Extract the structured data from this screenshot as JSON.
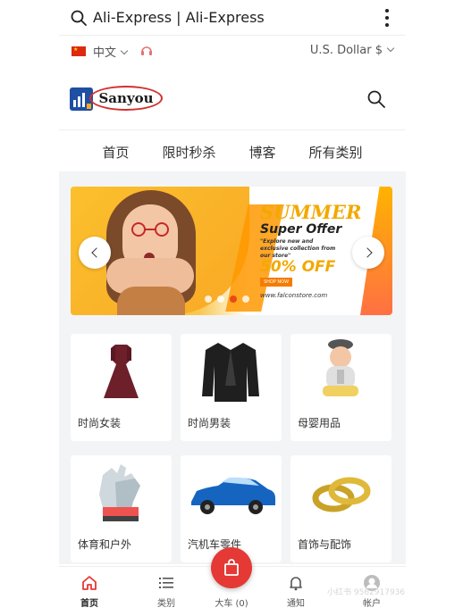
{
  "header": {
    "title": "Ali-Express | Ali-Express",
    "search_icon": "search-icon",
    "menu_icon": "more-vertical-icon"
  },
  "locale": {
    "language": "中文",
    "currency": "U.S. Dollar $",
    "support_icon": "headset-icon"
  },
  "brand": {
    "logo_text": "Sanyou"
  },
  "nav": {
    "items": [
      "首页",
      "限时秒杀",
      "博客",
      "所有类别"
    ]
  },
  "banner": {
    "headline": "SUMMER",
    "subheadline": "Super Offer",
    "tagline": "\"Explore new and exclusive collection from our store\"",
    "discount": "50% OFF",
    "button": "SHOP NOW",
    "url": "www.falconstore.com",
    "slides_total": 4,
    "active_slide": 3
  },
  "categories": [
    {
      "label": "时尚女装",
      "icon": "dress-icon"
    },
    {
      "label": "时尚男装",
      "icon": "suit-jacket-icon"
    },
    {
      "label": "母婴用品",
      "icon": "baby-icon"
    },
    {
      "label": "体育和户外",
      "icon": "gloves-icon"
    },
    {
      "label": "汽机车零件",
      "icon": "car-icon"
    },
    {
      "label": "首饰与配饰",
      "icon": "rings-icon"
    }
  ],
  "bottom_nav": {
    "home": "首页",
    "categories": "类别",
    "cart": "大车 (0)",
    "notifications": "通知",
    "account": "帐户"
  },
  "watermark": "小红书  9562917936",
  "colors": {
    "accent": "#e53935",
    "banner_yellow": "#f2a900"
  }
}
